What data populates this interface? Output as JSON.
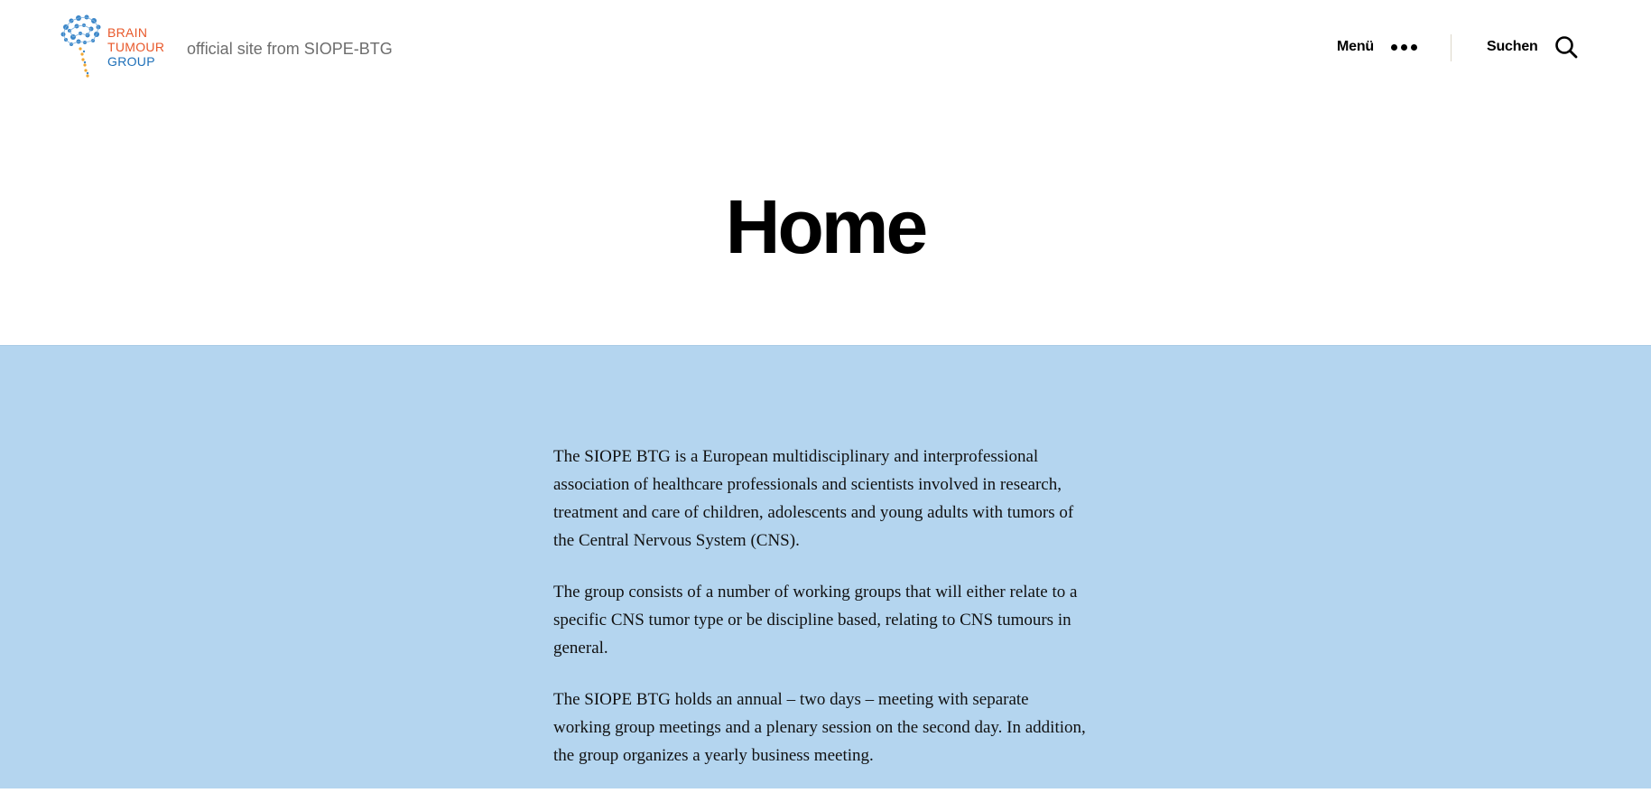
{
  "site": {
    "logo": {
      "line1": "BRAIN",
      "line2": "TUMOUR",
      "line3": "GROUP"
    },
    "tagline": "official site from SIOPE-BTG"
  },
  "header": {
    "menu_label": "Menü",
    "search_label": "Suchen"
  },
  "icons": {
    "menu": "more-horizontal-icon",
    "search": "search-icon"
  },
  "colors": {
    "content_background": "#b4d5ef",
    "logo_orange": "#e8582a",
    "logo_blue": "#1d6fb8",
    "tagline": "#6d6d6d"
  },
  "page": {
    "title": "Home",
    "paragraphs": [
      "The SIOPE BTG is a European multidisciplinary and interprofessional association of healthcare professionals and scientists involved in research, treatment and care of children, adolescents and young adults with tumors of the Central Nervous System (CNS).",
      "The group consists of a number of working groups that will either relate to a specific CNS tumor type or be discipline based, relating to CNS tumours in general.",
      "The SIOPE BTG holds an annual – two days – meeting with separate working group meetings and a plenary session on the second day. In addition, the group organizes a yearly business meeting."
    ]
  }
}
